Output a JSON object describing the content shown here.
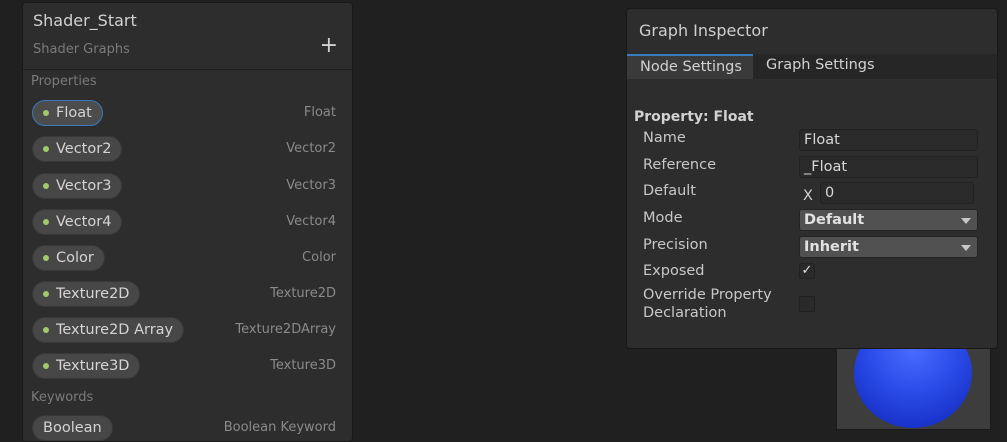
{
  "blackboard": {
    "title": "Shader_Start",
    "subtitle": "Shader Graphs",
    "add_label": "+",
    "properties_label": "Properties",
    "keywords_label": "Keywords",
    "properties": [
      {
        "name": "Float",
        "type": "Float",
        "selected": true
      },
      {
        "name": "Vector2",
        "type": "Vector2"
      },
      {
        "name": "Vector3",
        "type": "Vector3"
      },
      {
        "name": "Vector4",
        "type": "Vector4"
      },
      {
        "name": "Color",
        "type": "Color"
      },
      {
        "name": "Texture2D",
        "type": "Texture2D"
      },
      {
        "name": "Texture2D Array",
        "type": "Texture2DArray"
      },
      {
        "name": "Texture3D",
        "type": "Texture3D"
      }
    ],
    "keywords": [
      {
        "name": "Boolean",
        "type": "Boolean Keyword"
      }
    ]
  },
  "inspector": {
    "title": "Graph Inspector",
    "tabs": [
      {
        "label": "Node Settings",
        "active": true
      },
      {
        "label": "Graph Settings",
        "active": false
      }
    ],
    "heading": "Property: Float",
    "fields": {
      "name": {
        "label": "Name",
        "value": "Float"
      },
      "reference": {
        "label": "Reference",
        "value": "_Float"
      },
      "default": {
        "label": "Default",
        "axis": "X",
        "value": "0"
      },
      "mode": {
        "label": "Mode",
        "value": "Default"
      },
      "precision": {
        "label": "Precision",
        "value": "Inherit"
      },
      "exposed": {
        "label": "Exposed",
        "checked": true,
        "mark": "✓"
      },
      "override": {
        "label_line1": "Override Property",
        "label_line2": "Declaration",
        "checked": false
      }
    }
  },
  "preview": {
    "sphere_color": "#2a4be8"
  },
  "colors": {
    "accent": "#3a79bb",
    "property_dot": "#9ccc65"
  }
}
